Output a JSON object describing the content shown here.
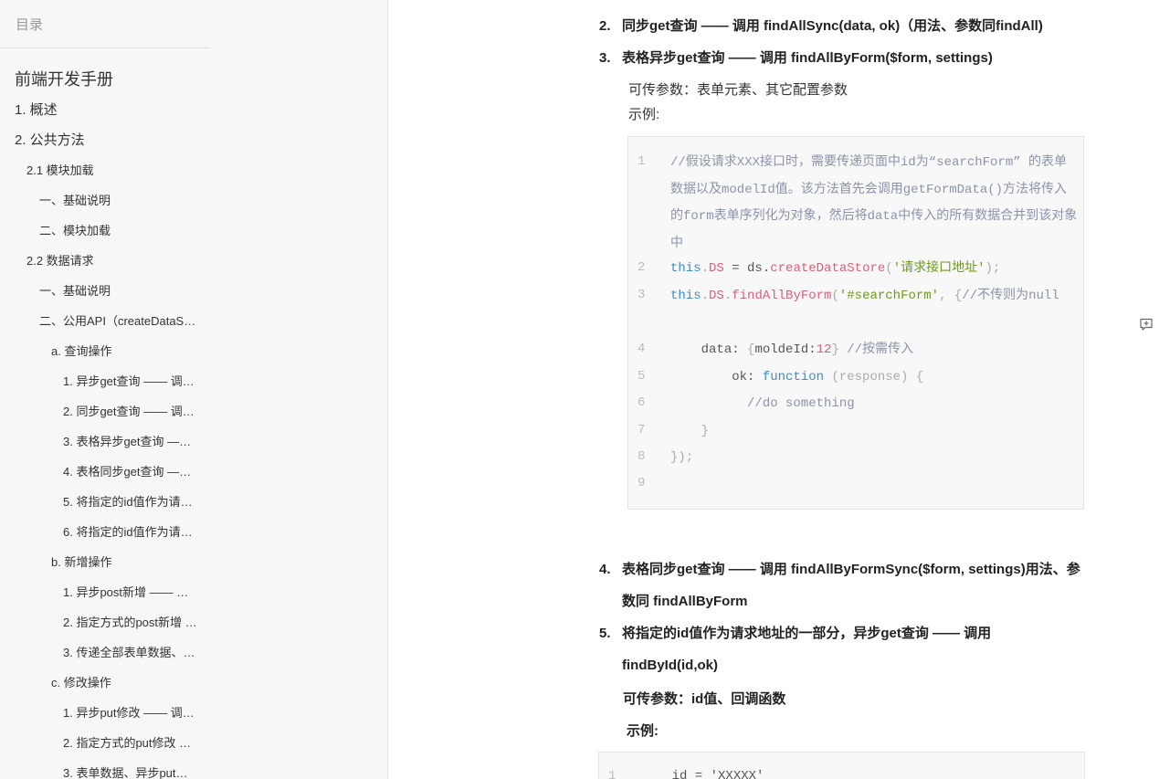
{
  "sidebar": {
    "header": "目录",
    "items": [
      {
        "label": "前端开发手册",
        "level": 0
      },
      {
        "label": "1. 概述",
        "level": 1
      },
      {
        "label": "2. 公共方法",
        "level": 1
      },
      {
        "label": "2.1 模块加载",
        "level": 2
      },
      {
        "label": "一、基础说明",
        "level": 3
      },
      {
        "label": "二、模块加载",
        "level": 3
      },
      {
        "label": "2.2 数据请求",
        "level": 2
      },
      {
        "label": "一、基础说明",
        "level": 3
      },
      {
        "label": "二、公用API（createDataS…",
        "level": 3
      },
      {
        "label": "a. 查询操作",
        "level": 4
      },
      {
        "label": "1. 异步get查询 —— 调…",
        "level": 5
      },
      {
        "label": "2. 同步get查询 —— 调…",
        "level": 5
      },
      {
        "label": "3. 表格异步get查询 —…",
        "level": 5
      },
      {
        "label": "4. 表格同步get查询 —…",
        "level": 5
      },
      {
        "label": "5. 将指定的id值作为请…",
        "level": 5
      },
      {
        "label": "6. 将指定的id值作为请…",
        "level": 5
      },
      {
        "label": "b. 新增操作",
        "level": 4
      },
      {
        "label": "1. 异步post新增 —— …",
        "level": 5
      },
      {
        "label": "2. 指定方式的post新增 …",
        "level": 5
      },
      {
        "label": "3. 传递全部表单数据、…",
        "level": 5
      },
      {
        "label": "c. 修改操作",
        "level": 4
      },
      {
        "label": "1. 异步put修改 —— 调…",
        "level": 5
      },
      {
        "label": "2. 指定方式的put修改 …",
        "level": 5
      },
      {
        "label": "3. 表单数据、异步put…",
        "level": 5
      }
    ]
  },
  "content": {
    "item2": {
      "num": "2.",
      "text": "同步get查询  —— 调用 findAllSync(data, ok)（用法、参数同findAll)"
    },
    "item3": {
      "num": "3.",
      "text": "表格异步get查询  —— 调用 findAllByForm($form, settings)"
    },
    "item3_params": "可传参数：表单元素、其它配置参数",
    "item3_example": "示例:",
    "code1": {
      "line_numbers": [
        "1",
        "2",
        "3",
        "4",
        "5",
        "6",
        "7",
        "8",
        "9"
      ],
      "l1": "//假设请求XXX接口时，需要传递页面中id为“searchForm” 的表单数据以及modelId值。该方法首先会调用getFormData()方法将传入的form表单序列化为对象，然后将data中传入的所有数据合并到该对象中",
      "l2": {
        "a": "this",
        "b": ".",
        "c": "DS",
        "d": " = ds.",
        "e": "createDataStore",
        "f": "(",
        "g": "'请求接口地址'",
        "h": ");"
      },
      "l3": {
        "a": "this",
        "b": ".",
        "c": "DS",
        "d": ".",
        "e": "findAllByForm",
        "f": "(",
        "g": "'#searchForm'",
        "h": ", {",
        "i": "//不传则为null"
      },
      "l4": {
        "a": "    data: ",
        "b": "{",
        "c": "moldeId:",
        "d": "12",
        "e": "}",
        "f": " //按需传入"
      },
      "l5": {
        "a": "        ok: ",
        "b": "function",
        "c": " (response) {"
      },
      "l6": "          //do something",
      "l7": "    }",
      "l8": "});",
      "l9": ""
    },
    "item4": {
      "num": "4.",
      "text": "表格同步get查询  —— 调用 findAllByFormSync($form, settings)用法、参数同 findAllByForm"
    },
    "item5": {
      "num": "5.",
      "text": "将指定的id值作为请求地址的一部分，异步get查询  —— 调用 findById(id,ok)"
    },
    "item5_params": "可传参数：id值、回调函数",
    "item5_example": "示例:",
    "code2": {
      "ln": "1",
      "text": "    id = 'XXXXX'"
    }
  },
  "icons": {
    "comment": "comment-add-icon"
  }
}
